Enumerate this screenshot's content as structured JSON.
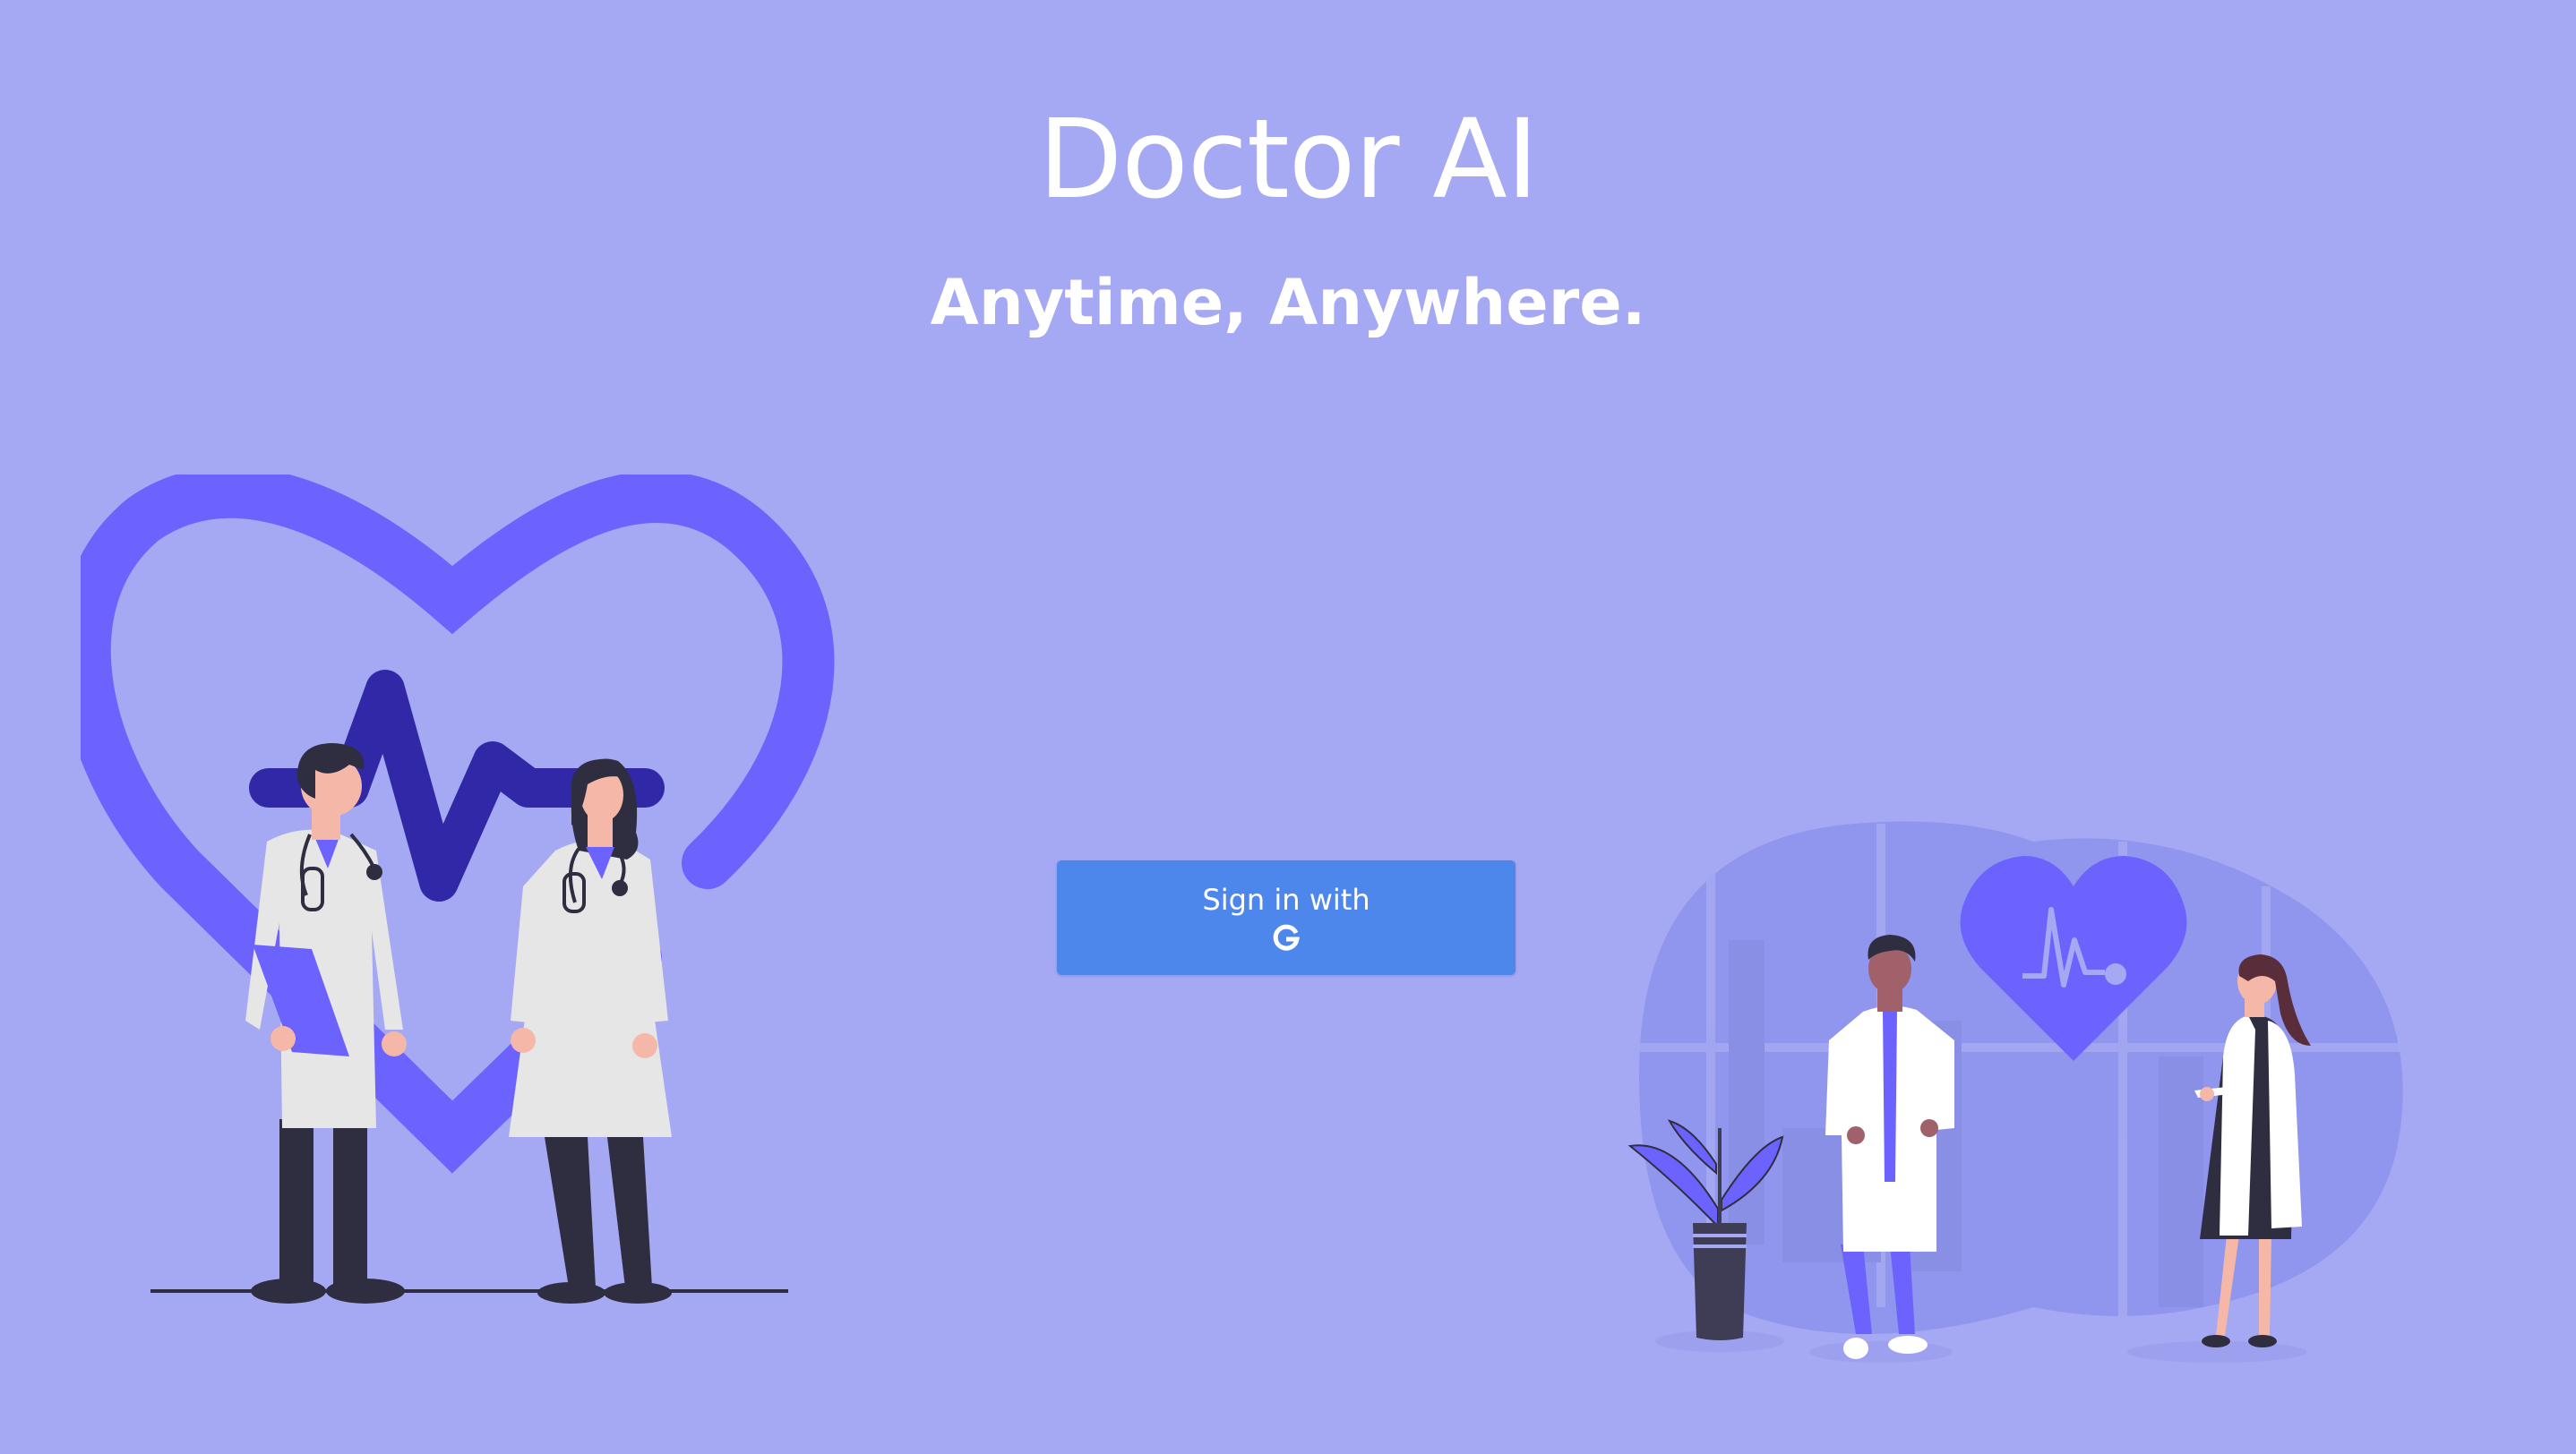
{
  "header": {
    "title": "Doctor AI",
    "tagline": "Anytime, Anywhere."
  },
  "auth": {
    "signin_label": "Sign in with",
    "provider_icon": "google-g-icon"
  },
  "colors": {
    "background": "#a5a8f2",
    "accent": "#6c63ff",
    "button": "#4e87ec",
    "text": "#ffffff"
  }
}
